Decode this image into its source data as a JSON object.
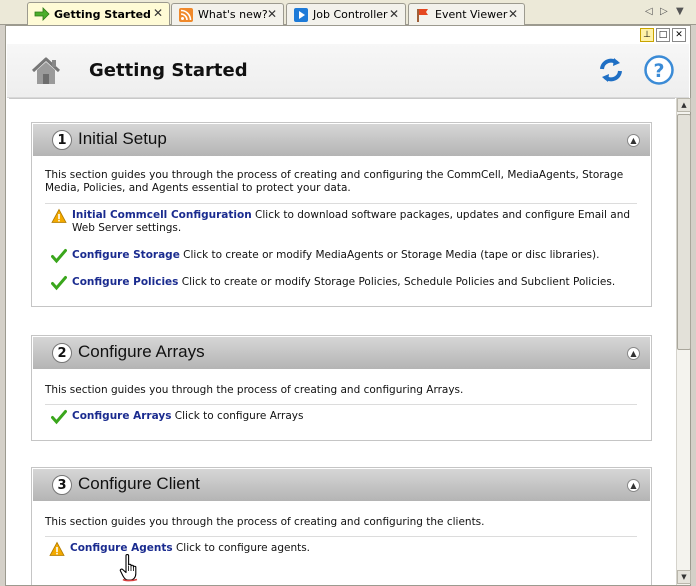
{
  "tabs": [
    {
      "label": "Getting Started",
      "icon": "arrow-right-icon",
      "active": true
    },
    {
      "label": "What's new?",
      "icon": "rss-icon",
      "active": false
    },
    {
      "label": "Job Controller",
      "icon": "play-icon",
      "active": false
    },
    {
      "label": "Event Viewer",
      "icon": "flag-icon",
      "active": false
    }
  ],
  "tab_close": "✕",
  "header": {
    "title": "Getting Started"
  },
  "sections": [
    {
      "number": "1",
      "title": "Initial Setup",
      "description": "This section guides you through the process of creating and configuring the CommCell, MediaAgents, Storage Media, Policies, and Agents essential to protect your data.",
      "tasks": [
        {
          "status": "warning",
          "link": "Initial Commcell Configuration",
          "text": " Click to download software packages, updates and configure Email and Web Server settings."
        },
        {
          "status": "done",
          "link": "Configure Storage",
          "text": " Click to create or modify MediaAgents or Storage Media (tape or disc libraries)."
        },
        {
          "status": "done",
          "link": "Configure Policies",
          "text": " Click to create or modify Storage Policies, Schedule Policies and Subclient Policies."
        }
      ]
    },
    {
      "number": "2",
      "title": "Configure Arrays",
      "description": "This section guides you through the process of creating and configuring Arrays.",
      "tasks": [
        {
          "status": "done",
          "link": "Configure Arrays",
          "text": " Click to configure Arrays"
        }
      ]
    },
    {
      "number": "3",
      "title": "Configure Client",
      "description": "This section guides you through the process of creating and configuring the clients.",
      "tasks": [
        {
          "status": "warning",
          "link": "Configure Agents",
          "text": " Click to configure agents."
        }
      ]
    }
  ],
  "colors": {
    "link": "#1a2b8f",
    "warning": "#f2a900",
    "done": "#3aa61c",
    "refresh": "#1f6fc4"
  }
}
